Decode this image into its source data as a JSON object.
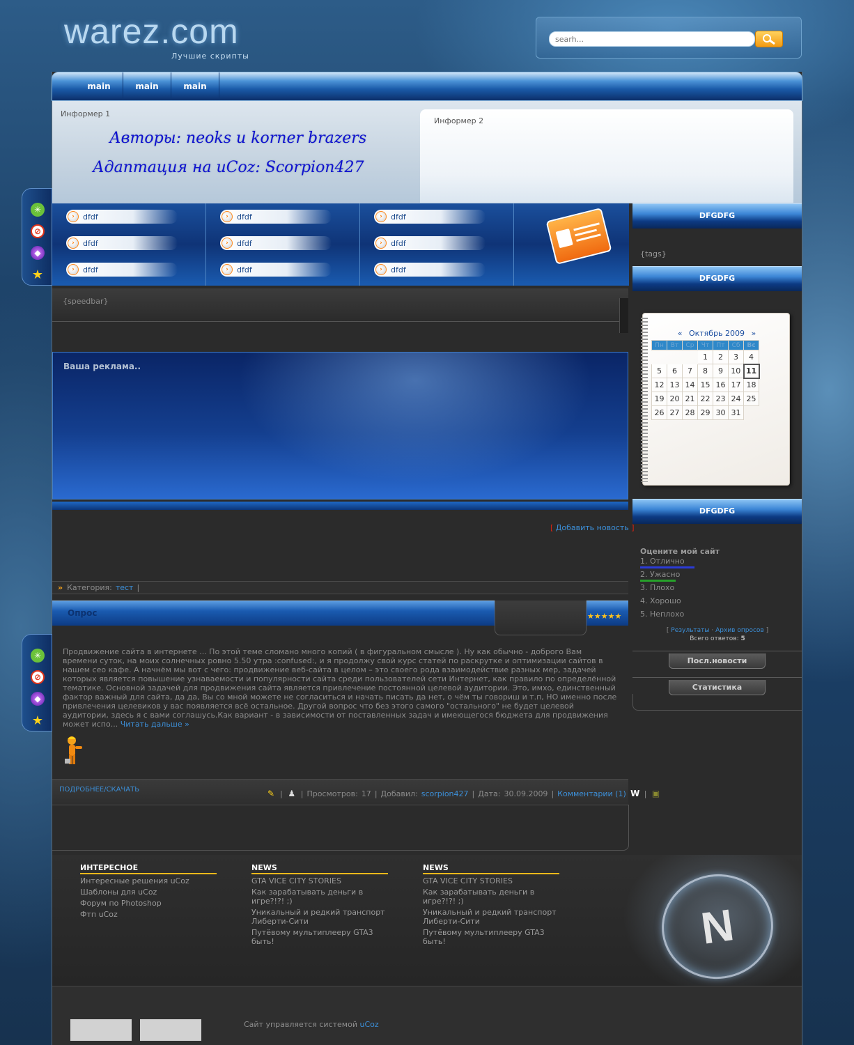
{
  "header": {
    "logo": "warez.com",
    "tagline": "Лучшие скрипты",
    "search_placeholder": "searh..."
  },
  "nav": [
    "main",
    "main",
    "main"
  ],
  "informer1": {
    "label": "Информер 1",
    "line1": "Авторы: neoks и korner brazers",
    "line2": "Адаптация на uCoz: Scorpion427"
  },
  "informer2": {
    "label": "Информер 2"
  },
  "links": [
    [
      "dfdf",
      "dfdf",
      "dfdf"
    ],
    [
      "dfdf",
      "dfdf",
      "dfdf"
    ],
    [
      "dfdf",
      "dfdf",
      "dfdf"
    ]
  ],
  "speedbar": "{speedbar}",
  "ad": {
    "label": "Ваша реклама.."
  },
  "add_news": {
    "open": "[",
    "link": "Добавить новость",
    "close": "]"
  },
  "category": {
    "label": "Категория:",
    "link": "тест",
    "sep": "|"
  },
  "article": {
    "title": "Опрос",
    "stars": "★★★★★",
    "body": "Продвижение сайта в интернете ... По этой теме сломано много копий ( в фигуральном смысле ). Ну как обычно - доброго Вам времени суток, на моих солнечных ровно 5.50 утра :confused:, и я продолжу свой курс статей по раскрутке и оптимизации сайтов в нашем сео кафе. А начнём мы вот с чего: продвижение веб-сайта в целом – это своего рода взаимодействие разных мер, задачей которых является повышение узнаваемости и популярности сайта среди пользователей сети Интернет, как правило по определённой тематике. Основной задачей для продвижения сайта является привлечение постоянной целевой аудитории. Это, имхо, единственный фактор важный для сайта, да да, Вы со мной можете не согласиться и начать писать да нет, о чём ты говориш и т.п, НО именно после привлечения целевиков у вас появляется всё остальное. Другой вопрос что без этого самого \"остального\" не будет целевой аудитории, здесь я с вами соглашусь.Как вариант - в зависимости от поставленных задач и имеющегося бюджета для продвижения может испо...",
    "read_more": "Читать дальше »",
    "more_download": "ПОДРОБНЕЕ/СКАЧАТЬ",
    "views_label": "Просмотров:",
    "views": "17",
    "added_label": "Добавил:",
    "author": "scorpion427",
    "date_label": "Дата:",
    "date": "30.09.2009",
    "comments": "Комментарии (1)"
  },
  "sidebar": {
    "block1_title": "DFGDFG",
    "tags": "{tags}",
    "block2_title": "DFGDFG",
    "block3_title": "DFGDFG",
    "news_btn": "Посл.новости",
    "stats_btn": "Статистика"
  },
  "calendar": {
    "prev": "«",
    "month": "Октябрь 2009",
    "next": "»",
    "dow": [
      "Пн",
      "Вт",
      "Ср",
      "Чт",
      "Пт",
      "Сб",
      "Вс"
    ],
    "weeks": [
      [
        "",
        "",
        "",
        "1",
        "2",
        "3",
        "4"
      ],
      [
        "5",
        "6",
        "7",
        "8",
        "9",
        "10",
        "11"
      ],
      [
        "12",
        "13",
        "14",
        "15",
        "16",
        "17",
        "18"
      ],
      [
        "19",
        "20",
        "21",
        "22",
        "23",
        "24",
        "25"
      ],
      [
        "26",
        "27",
        "28",
        "29",
        "30",
        "31",
        ""
      ]
    ],
    "today": "11"
  },
  "poll": {
    "question": "Оцените мой сайт",
    "options": [
      {
        "label": "1. Отлично",
        "share": 0.35,
        "color": "#2b3bd6"
      },
      {
        "label": "2. Ужасно",
        "share": 0.23,
        "color": "#26a02a"
      },
      {
        "label": "3. Плохо",
        "share": 0,
        "color": "#888888"
      },
      {
        "label": "4. Хорошо",
        "share": 0,
        "color": "#888888"
      },
      {
        "label": "5. Неплохо",
        "share": 0,
        "color": "#888888"
      }
    ],
    "open": "[",
    "results": "Результаты",
    "dot": "·",
    "archive": "Архив опросов",
    "close": "]",
    "total_label": "Всего ответов:",
    "total": "5"
  },
  "footer": {
    "cols": [
      {
        "head": "ИНТЕРЕСНОЕ",
        "links": [
          "Интересные решения uCoz",
          "Шаблоны для uCoz",
          "Форум по Photoshop",
          "Фтп uCoz"
        ]
      },
      {
        "head": "NEWS",
        "links": [
          "GTA VICE CITY STORIES",
          "Как зарабатывать деньги в игре?!?! ;)",
          "Уникальный и редкий транспорт Либерти-Сити",
          "Путёвому мультиплееру GTA3 быть!"
        ]
      },
      {
        "head": "NEWS",
        "links": [
          "GTA VICE CITY STORIES",
          "Как зарабатывать деньги в игре?!?! ;)",
          "Уникальный и редкий транспорт Либерти-Сити",
          "Путёвому мультиплееру GTA3 быть!"
        ]
      }
    ],
    "logo_letter": "N",
    "powered": "Сайт управляется системой",
    "powered_link": "uCoz"
  }
}
